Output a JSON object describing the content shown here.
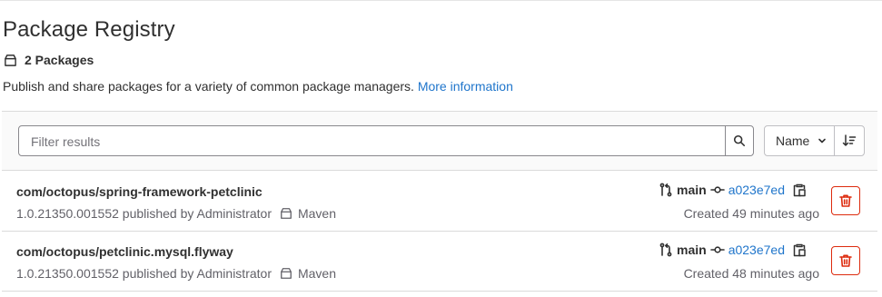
{
  "page": {
    "title": "Package Registry",
    "package_count": "2 Packages",
    "description": "Publish and share packages for a variety of common package managers.",
    "more_info_link": "More information"
  },
  "filter": {
    "placeholder": "Filter results",
    "sort_label": "Name"
  },
  "packages": [
    {
      "name": "com/octopus/spring-framework-petclinic",
      "meta": "1.0.21350.001552 published by Administrator",
      "type": "Maven",
      "branch": "main",
      "commit": "a023e7ed",
      "created": "Created 49 minutes ago"
    },
    {
      "name": "com/octopus/petclinic.mysql.flyway",
      "meta": "1.0.21350.001552 published by Administrator",
      "type": "Maven",
      "branch": "main",
      "commit": "a023e7ed",
      "created": "Created 48 minutes ago"
    }
  ],
  "colors": {
    "link": "#1f75cb",
    "danger": "#dd2b0e",
    "text": "#303030",
    "muted": "#626168"
  },
  "icons": {
    "package": "package-icon",
    "search": "search-icon",
    "chevron": "chevron-down-icon",
    "sort": "sort-lowest-icon",
    "branch": "branch-icon",
    "commit": "commit-icon",
    "copy": "copy-to-clipboard-icon",
    "delete": "remove-icon"
  }
}
